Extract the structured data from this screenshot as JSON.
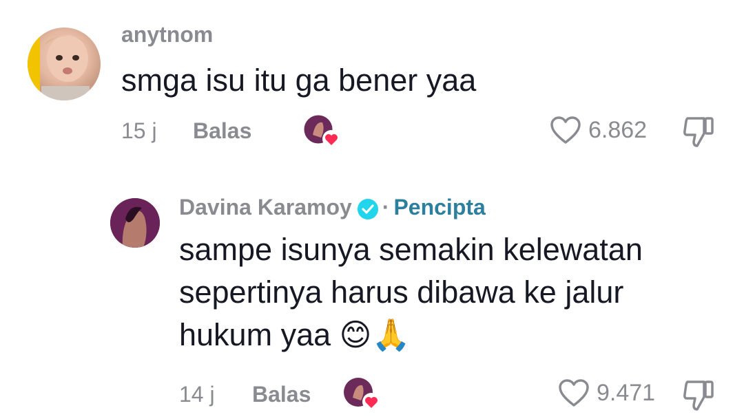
{
  "comments": [
    {
      "username": "anytnom",
      "text": "smga isu itu ga bener yaa",
      "time": "15 j",
      "reply_label": "Balas",
      "likes": "6.862"
    },
    {
      "username": "Davina Karamoy",
      "creator_label": "Pencipta",
      "separator": "·",
      "text_lines": [
        "sampe isunya semakin kelewatan",
        "sepertinya harus dibawa ke jalur",
        "hukum yaa 😊🙏"
      ],
      "time": "14 j",
      "reply_label": "Balas",
      "likes": "9.471"
    }
  ],
  "colors": {
    "muted": "#8a8b91",
    "text": "#161823",
    "creator": "#2d7f9e",
    "verified": "#20d5ec",
    "heart_badge": "#fe2c55"
  },
  "icons": [
    "verified-badge-icon",
    "heart-outline-icon",
    "thumbs-down-icon",
    "liked-by-creator-icon"
  ]
}
